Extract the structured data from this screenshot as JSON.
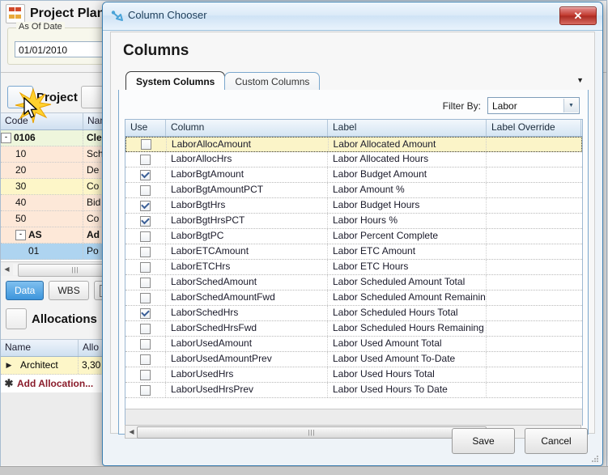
{
  "background_app": {
    "title": "Project Plan",
    "app_icon": "project-plan-icon",
    "as_of_date": {
      "legend": "As Of Date",
      "value": "01/01/2010"
    },
    "project_section": {
      "button_icon": "project-icon",
      "label": "Project",
      "second_button_icon": "edit-icon"
    },
    "project_grid": {
      "columns": [
        "Code",
        "Name"
      ],
      "rows": [
        {
          "code": "0106",
          "name": "Cle",
          "indent": 0,
          "expander": "-",
          "bold": true,
          "row_color": "green"
        },
        {
          "code": "10",
          "name": "Sch",
          "indent": 1,
          "expander": "",
          "bold": false,
          "row_color": "peach"
        },
        {
          "code": "20",
          "name": "De",
          "indent": 1,
          "expander": "",
          "bold": false,
          "row_color": "peach"
        },
        {
          "code": "30",
          "name": "Co",
          "indent": 1,
          "expander": "",
          "bold": false,
          "row_color": "yellow"
        },
        {
          "code": "40",
          "name": "Bid",
          "indent": 1,
          "expander": "",
          "bold": false,
          "row_color": "peach"
        },
        {
          "code": "50",
          "name": "Co",
          "indent": 1,
          "expander": "",
          "bold": false,
          "row_color": "peach"
        },
        {
          "code": "AS",
          "name": "Ad",
          "indent": 1,
          "expander": "-",
          "bold": true,
          "row_color": "peach"
        },
        {
          "code": "01",
          "name": "Po",
          "indent": 2,
          "expander": "",
          "bold": false,
          "row_color": "blue"
        }
      ]
    },
    "view_buttons": {
      "data": "Data",
      "wbs": "WBS",
      "copy_icon": "copy-icon"
    },
    "allocations": {
      "title": "Allocations",
      "icon": "allocations-icon",
      "columns": [
        "Name",
        "Allo"
      ],
      "rows": [
        {
          "name": "Architect",
          "alloc": "3,30"
        }
      ],
      "add_row_label": "Add Allocation...",
      "add_row_icon": "asterisk-icon"
    },
    "cursor": {
      "icon": "mouse-cursor",
      "click_effect": "click-burst"
    }
  },
  "dialog": {
    "titlebar": {
      "icon": "column-chooser-icon",
      "title": "Column Chooser",
      "close_label": "✕"
    },
    "heading": "Columns",
    "tabs": [
      {
        "id": "system-columns",
        "label": "System Columns",
        "active": true
      },
      {
        "id": "custom-columns",
        "label": "Custom Columns",
        "active": false
      }
    ],
    "tab_overflow_icon": "chevron-down-icon",
    "filter": {
      "label": "Filter By:",
      "value": "Labor",
      "arrow_icon": "chevron-down-icon"
    },
    "grid": {
      "headers": [
        "Use",
        "Column",
        "Label",
        "Label Override"
      ],
      "rows": [
        {
          "use": false,
          "column": "LaborAllocAmount",
          "label": "Labor Allocated Amount",
          "override": "",
          "highlighted": true
        },
        {
          "use": false,
          "column": "LaborAllocHrs",
          "label": "Labor Allocated Hours",
          "override": "",
          "highlighted": false
        },
        {
          "use": true,
          "column": "LaborBgtAmount",
          "label": "Labor Budget Amount",
          "override": "",
          "highlighted": false
        },
        {
          "use": false,
          "column": "LaborBgtAmountPCT",
          "label": "Labor Amount %",
          "override": "",
          "highlighted": false
        },
        {
          "use": true,
          "column": "LaborBgtHrs",
          "label": "Labor Budget Hours",
          "override": "",
          "highlighted": false
        },
        {
          "use": true,
          "column": "LaborBgtHrsPCT",
          "label": "Labor Hours %",
          "override": "",
          "highlighted": false
        },
        {
          "use": false,
          "column": "LaborBgtPC",
          "label": "Labor Percent Complete",
          "override": "",
          "highlighted": false
        },
        {
          "use": false,
          "column": "LaborETCAmount",
          "label": "Labor ETC Amount",
          "override": "",
          "highlighted": false
        },
        {
          "use": false,
          "column": "LaborETCHrs",
          "label": "Labor ETC Hours",
          "override": "",
          "highlighted": false
        },
        {
          "use": false,
          "column": "LaborSchedAmount",
          "label": "Labor Scheduled Amount Total",
          "override": "",
          "highlighted": false
        },
        {
          "use": false,
          "column": "LaborSchedAmountFwd",
          "label": "Labor Scheduled Amount Remaining",
          "override": "",
          "highlighted": false
        },
        {
          "use": true,
          "column": "LaborSchedHrs",
          "label": "Labor Scheduled Hours Total",
          "override": "",
          "highlighted": false
        },
        {
          "use": false,
          "column": "LaborSchedHrsFwd",
          "label": "Labor Scheduled Hours Remaining",
          "override": "",
          "highlighted": false
        },
        {
          "use": false,
          "column": "LaborUsedAmount",
          "label": "Labor Used Amount Total",
          "override": "",
          "highlighted": false
        },
        {
          "use": false,
          "column": "LaborUsedAmountPrev",
          "label": "Labor Used Amount To-Date",
          "override": "",
          "highlighted": false
        },
        {
          "use": false,
          "column": "LaborUsedHrs",
          "label": "Labor Used Hours Total",
          "override": "",
          "highlighted": false
        },
        {
          "use": false,
          "column": "LaborUsedHrsPrev",
          "label": "Labor Used Hours To Date",
          "override": "",
          "highlighted": false
        }
      ]
    },
    "scrollbar": {
      "left_arrow": "◀",
      "right_arrow": "▶",
      "thumb_icon": "scroll-grip"
    },
    "buttons": {
      "save": "Save",
      "cancel": "Cancel"
    }
  },
  "colors": {
    "dialog_border": "#3c7fb1",
    "close_button": "#c23a2f",
    "highlight_row": "#fbf4c8",
    "selected_row": "#aed4f0",
    "checkbox_check": "#3b5f97",
    "tab_active_bg": "#fdfdfd",
    "accent_blue": "#3d95dc"
  }
}
